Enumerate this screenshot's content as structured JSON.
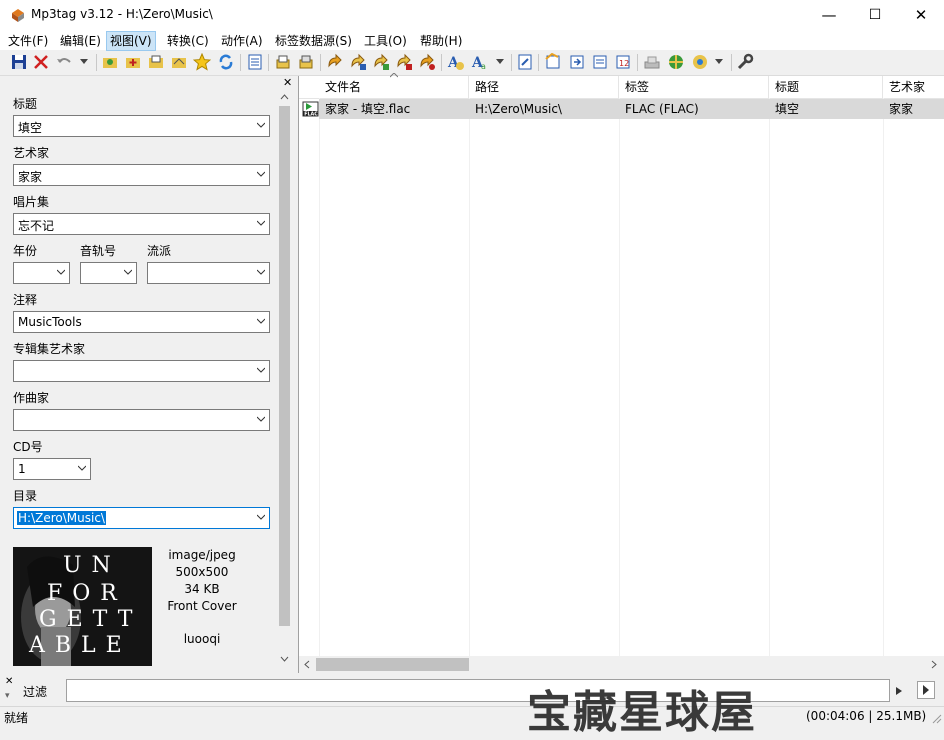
{
  "window": {
    "title": "Mp3tag v3.12  -  H:\\Zero\\Music\\",
    "minimize": "—",
    "maximize": "☐",
    "close": "✕"
  },
  "menu": [
    "文件(F)",
    "编辑(E)",
    "视图(V)",
    "转换(C)",
    "动作(A)",
    "标签数据源(S)",
    "工具(O)",
    "帮助(H)"
  ],
  "toolbar_icons": [
    "save-icon",
    "remove-tag-icon",
    "undo-icon",
    "dropdown-icon",
    "change-dir-icon",
    "add-dir-icon",
    "open-folder-icon",
    "add-folder-icon",
    "favorite-icon",
    "refresh-icon",
    "tag-panel-icon",
    "export-icon",
    "import-icon",
    "tag-from-filename-icon",
    "filename-from-tag-icon",
    "filename-from-filename-icon",
    "text-from-tag-icon",
    "autonumber-icon",
    "case-conversion-icon",
    "case-dropdown-icon",
    "extended-tags-icon",
    "web-source-1-icon",
    "web-source-2-icon",
    "web-source-3-icon",
    "numbering-icon",
    "freedb-icon",
    "musicbrainz-icon",
    "discogs-icon",
    "discogs-dropdown-icon",
    "settings-icon"
  ],
  "fields": {
    "title_label": "标题",
    "title_value": "填空",
    "artist_label": "艺术家",
    "artist_value": "家家",
    "album_label": "唱片集",
    "album_value": "忘不记",
    "year_label": "年份",
    "year_value": "",
    "track_label": "音轨号",
    "track_value": "",
    "genre_label": "流派",
    "genre_value": "",
    "comment_label": "注释",
    "comment_value": "MusicTools",
    "albumartist_label": "专辑集艺术家",
    "albumartist_value": "",
    "composer_label": "作曲家",
    "composer_value": "",
    "disc_label": "CD号",
    "disc_value": "1",
    "directory_label": "目录",
    "directory_value": "H:\\Zero\\Music\\"
  },
  "cover": {
    "mime": "image/jpeg",
    "dimensions": "500x500",
    "size": "34 KB",
    "type": "Front Cover",
    "description": "luooqi",
    "art_text": [
      "UN",
      "FOR",
      "GETT",
      "ABLE"
    ]
  },
  "columns": [
    "文件名",
    "路径",
    "标签",
    "标题",
    "艺术家"
  ],
  "rows": [
    {
      "filename": "家家 - 填空.flac",
      "path": "H:\\Zero\\Music\\",
      "tag": "FLAC (FLAC)",
      "title": "填空",
      "artist": "家家"
    }
  ],
  "filter": {
    "label": "过滤",
    "value": ""
  },
  "status": {
    "left": "就绪",
    "right": "(00:04:06 | 25.1MB)"
  },
  "watermark": "宝藏星球屋",
  "colors": {
    "selection": "#d9d9d9",
    "accent": "#0078d7",
    "directory_highlight": "#0078d7"
  }
}
